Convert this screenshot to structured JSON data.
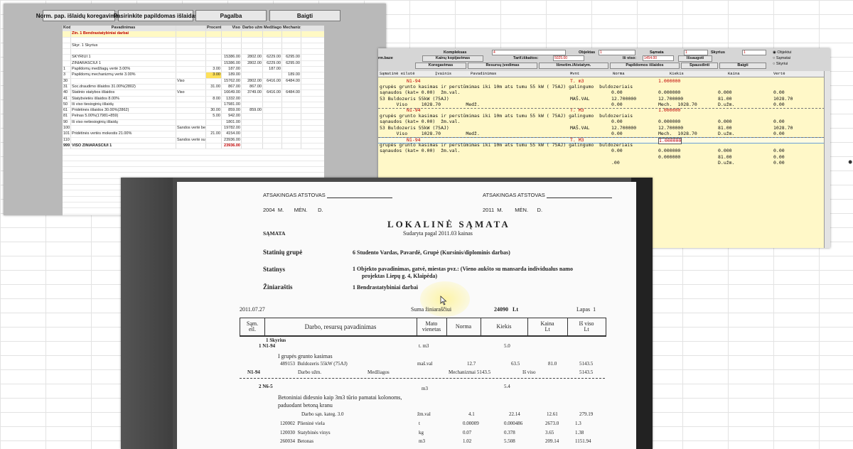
{
  "winA": {
    "toolbar": [
      "Norm. pap. išlaidų koregavimas",
      "Pasirinkite papildomas išlaidas",
      "Pagalba",
      "Baigti"
    ],
    "headers": [
      "Kodai",
      "Pavadinimas",
      "",
      "Procent",
      "Viso",
      "Darbo užmok.",
      "Medžiagos",
      "Mechanizmai"
    ],
    "rows": [
      [
        "",
        "Žin. 1 Bendrastatybiniai darbai",
        "",
        "",
        "",
        "",
        "",
        ""
      ],
      [
        "",
        "",
        "",
        "",
        "",
        "",
        "",
        ""
      ],
      [
        "",
        "Skyr. 1 Skyrius",
        "",
        "",
        "",
        "",
        "",
        ""
      ],
      [
        "",
        "",
        "",
        "",
        "",
        "",
        "",
        ""
      ],
      [
        "",
        "SKYRIUI 1",
        "",
        "",
        "15386.00",
        "2802.00",
        "6229.00",
        "6295.00"
      ],
      [
        "",
        "ŽINIARAŠČIUI 1",
        "",
        "",
        "15386.00",
        "2802.00",
        "6229.00",
        "6295.00"
      ],
      [
        "1",
        "Papildomų medžiagų vertė 3.00%",
        "",
        "3.00",
        "187.00",
        "",
        "187.00",
        ""
      ],
      [
        "3",
        "Papildomų mechanizmų vertė 3.00%",
        "",
        "3.00",
        "189.00",
        "",
        "",
        "189.00"
      ],
      [
        "30",
        "",
        "Viso",
        "",
        "15762.00",
        "2802.00",
        "6416.00",
        "6484.00"
      ],
      [
        "31",
        "Soc.draudimo išlaidos 31.00%(2802)",
        "",
        "31.00",
        "867.00",
        "867.00",
        "",
        ""
      ],
      [
        "40",
        "Statinio statybos išlaidos",
        "Viso",
        "",
        "16649.00",
        "3749.00",
        "6416.00",
        "6484.00"
      ],
      [
        "41",
        "Statybvietės išlaidos 8.00%",
        "",
        "8.00",
        "1332.00",
        "",
        "",
        ""
      ],
      [
        "50",
        "Iš viso tiesioginių išlaidų",
        "",
        "",
        "17981.00",
        "",
        "",
        ""
      ],
      [
        "61",
        "Pridėtinės išlaidos 30.00%(2862)",
        "",
        "30.00",
        "859.00",
        "859.00",
        "",
        ""
      ],
      [
        "81",
        "Pelnas 5.00%(17981+859)",
        "",
        "5.00",
        "942.00",
        "",
        "",
        ""
      ],
      [
        "90",
        "Iš viso netiesioginių išlaidų",
        "",
        "",
        "1801.00",
        "",
        "",
        ""
      ],
      [
        "100",
        "",
        "Sandos vertė be PVM",
        "",
        "19782.00",
        "",
        "",
        ""
      ],
      [
        "101",
        "Pridėtinės vertės mokestis 21.00%",
        "",
        "21.00",
        "4154.00",
        "",
        "",
        ""
      ],
      [
        "110",
        "",
        "Sandos vertė su PVM",
        "",
        "23936.00",
        "",
        "",
        ""
      ],
      [
        "999",
        "VISO ŽINIARAŠČIUI 1",
        "",
        "",
        "23936.00",
        "",
        "",
        ""
      ]
    ]
  },
  "winB": {
    "top": {
      "kompleksas_label": "Kompleksas",
      "kompleksas_val": "4",
      "objektas_label": "Objektas",
      "objektas_val": "1",
      "samata_label": "Sąmata",
      "samata_val": "1",
      "skyrius_label": "Skyrius",
      "skyrius_val": "1",
      "baze_label": "rm.baze",
      "kainu_label": "Kainų kopijavimas",
      "tarif_label": "Tarif.iškaitos:",
      "tarif_val": "5025.00",
      "isviso_label": "Iš viso:",
      "isviso_val": "1454.00",
      "issaugoti": "Išsaugoti",
      "radios": [
        "Objektui",
        "Sąmatai",
        "Skyriui"
      ]
    },
    "buttons": [
      "Koregavimas",
      "Resursų įvedimas",
      "Išmetim./Atstatym.",
      "Papildomos išlaidos",
      "Spausdinti",
      "Baigti"
    ],
    "headers": [
      "Sąmatinė eilutė",
      "Įvainis",
      "Pavadinimas",
      "Mvnt",
      "Norma",
      "Kiekis",
      "Kaina",
      "Vertė"
    ],
    "rows": [
      {
        "t": "N1-94",
        "m": "T. m3",
        "k": "1.000000",
        "red": true
      },
      {
        "t": "grupės grunto kasimas ir perstūmimas iki 10m ats tumu 55 kW ( 75AJ) galingumo  buldozeriais"
      },
      {
        "t": "sąnaudos (kat= 0.00)  žm.val.",
        "n": "0.00",
        "k": "0.000000",
        "p": "0.000",
        "v": "0.00"
      },
      {
        "t": "53 Buldozeris 55kW (75AJ)",
        "m": "MAŠ.VAL",
        "n": "12.700000",
        "k": "12.700000",
        "p": "81.00",
        "v": "1028.70"
      },
      {
        "t": "      Viso     1028.70         Medž.",
        "n": "0.00",
        "k": "Mech.  1028.70",
        "p": "D.užm.",
        "v": "0.00"
      },
      {
        "t": "N1-94",
        "m": "T. M3",
        "k": "1.000000",
        "red": true
      },
      {
        "t": "grupės grunto kasimas ir perstūmimas iki 10m ats tumu 55 kW ( 75AJ) galingumo  buldozeriais"
      },
      {
        "t": "sąnaudos (kat= 0.00)  žm.val.",
        "n": "0.00",
        "k": "0.000000",
        "p": "0.000",
        "v": "0.00"
      },
      {
        "t": "53 Buldozeris 55kW (75AJ)",
        "m": "MAŠ.VAL",
        "n": "12.700000",
        "k": "12.700000",
        "p": "81.00",
        "v": "1028.70"
      },
      {
        "t": "      Viso     1028.70         Medž.",
        "n": "0.00",
        "k": "Mech.  1028.70",
        "p": "D.užm.",
        "v": "0.00"
      },
      {
        "t": "N1-94",
        "m": "T. M3",
        "k": "1.000000",
        "red": true,
        "sel": true
      },
      {
        "t": "grupės grunto kasimas ir perstūmimas iki 10m ats tumu 55 kW ( 75AJ) galingumo  buldozeriais"
      },
      {
        "t": "sąnaudos (kat= 0.00)  žm.val.",
        "n": "0.00",
        "k": "0.000000",
        "p": "0.000",
        "v": "0.00"
      },
      {
        "t": "",
        "k": "0.000000",
        "p": "81.00",
        "v": "0.00"
      },
      {
        "t": "",
        "n": ".00",
        "p": "D.užm.",
        "v": "0.00"
      }
    ]
  },
  "doc": {
    "atsakingas_left": "ATSAKINGAS ATSTOVAS",
    "atsakingas_right": "ATSAKINGAS ATSTOVAS",
    "date_left": "2004  M.       MĖN.       D.",
    "date_right": "2011  M.        MĖN.      D.",
    "title": "LOKALINĖ SĄMATA",
    "samata_label": "SĄMATA",
    "samata_value": "Sudaryta pagal 2011.03 kainas",
    "grupe_label": "Statinių grupė",
    "grupe_value": "6  Studento Vardas, Pavardė, Grupė (Kursinis/diplominis darbas)",
    "statinys_label": "Statinys",
    "statinys_value1": "1  Objekto pavadinimas, gatvė, miestas pvz.: (Vieno aukšto su mansarda individualus namo",
    "statinys_value2": "projektas Liepų g. 4, Klaipėda)",
    "ziniarastis_label": "Žiniaraštis",
    "ziniarastis_value": "1  Bendrastatybiniai darbai",
    "date": "2011.07.27",
    "suma_label": "Suma žiniaraščiui",
    "suma_value": "24090   Lt",
    "lapas": "Lapas  1",
    "table_headers": [
      "Sąm.\neil.",
      "Darbo, resursų pavadinimas",
      "Mato\nvienetas",
      "Norma",
      "Kiekis",
      "Kaina\nLt",
      "Iš viso\nLt"
    ],
    "skyrius": "1  Skyrius",
    "item1_num": "1  N1-94",
    "item1_unit": "t. m3",
    "item1_qty": "5.0",
    "item1_desc": "I grupės grunto kasimas",
    "res1_code": "489153  Buldozeris 55kW (75AJ)",
    "res1_unit": "maš.val",
    "res1_norma": "12.7",
    "res1_kiekis": "63.5",
    "res1_kaina": "81.0",
    "res1_viso": "5143.5",
    "sum1_code": "N1-94",
    "sum1_darbo": "Darbo užm.",
    "sum1_medz": "Medžiagos",
    "sum1_mech": "Mechanizmai 5143.5",
    "sum1_isviso": "Iš viso",
    "sum1_val": "5143.5",
    "item2_num": "2  N6-5",
    "item2_unit": "m3",
    "item2_qty": "5.4",
    "item2_desc1": "Betoniniai didesnio kaip 3m3 tūrio pamatai kolonoms,",
    "item2_desc2": "paduodant betoną kranu",
    "item2_sub": "Darbo sąn. kateg. 3.0",
    "item2_sub_unit": "žm.val",
    "item2_sub_norma": "4.1",
    "item2_sub_kiekis": "22.14",
    "item2_sub_kaina": "12.61",
    "item2_sub_viso": "279.19",
    "res": [
      {
        "code": "120002  Plieninė viela",
        "unit": "t",
        "norma": "0.00009",
        "kiekis": "0.000486",
        "kaina": "2673.0",
        "viso": "1.3"
      },
      {
        "code": "120030  Statybinės vinys",
        "unit": "kg",
        "norma": "0.07",
        "kiekis": "0.378",
        "kaina": "3.65",
        "viso": "1.38"
      },
      {
        "code": "260034  Betonas",
        "unit": "m3",
        "norma": "1.02",
        "kiekis": "5.508",
        "kaina": "209.14",
        "viso": "1151.94"
      }
    ]
  }
}
